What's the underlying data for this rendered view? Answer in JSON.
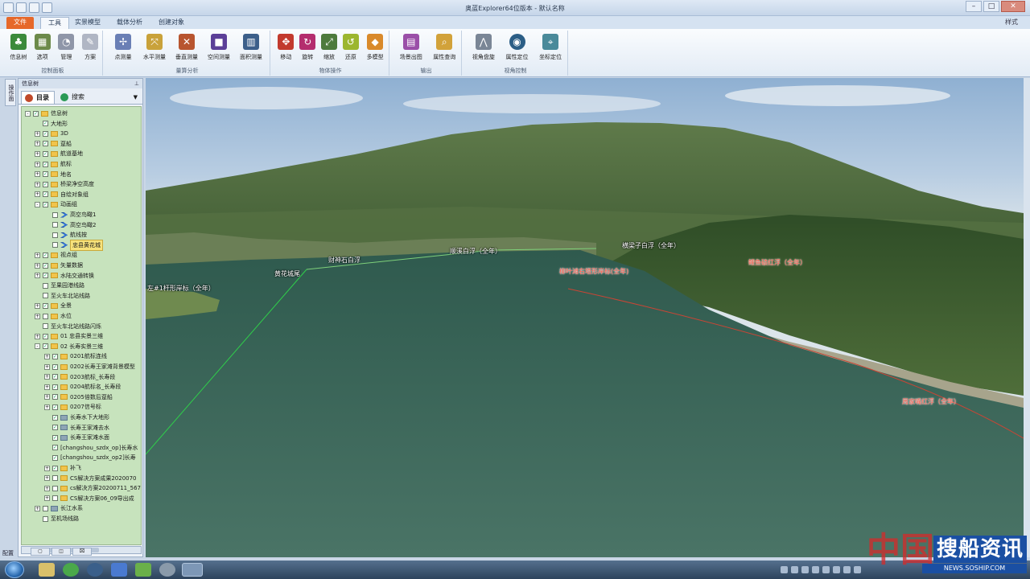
{
  "window": {
    "title": "奥蓝Explorer64位版本 - 默认名称"
  },
  "tabs": [
    {
      "label": "文件"
    },
    {
      "label": "工具"
    },
    {
      "label": "实景模型"
    },
    {
      "label": "载体分析"
    },
    {
      "label": "创建对象"
    }
  ],
  "style_label": "样式",
  "ribbon": {
    "groups": [
      {
        "label": "控制面板",
        "buttons": [
          "信息树",
          "选项",
          "管理",
          "方案"
        ]
      },
      {
        "label": "量算分析",
        "buttons": [
          "点测量",
          "水平测量",
          "垂直测量",
          "空间测量",
          "面积测量"
        ]
      },
      {
        "label": "物体操作",
        "buttons": [
          "移动",
          "旋转",
          "缩放",
          "还原",
          "多模型"
        ]
      },
      {
        "label": "输出",
        "buttons": [
          "场景出图",
          "属性查询"
        ]
      },
      {
        "label": "视角控制",
        "buttons": [
          "视角盘旋",
          "属性定位",
          "坐标定位"
        ]
      }
    ]
  },
  "panel": {
    "header": "信息树",
    "vertical_tab": "操作面",
    "tab_directory": "目录",
    "tab_search": "搜索",
    "config_label": "配置"
  },
  "tree": [
    {
      "label": "信息树",
      "level": 1,
      "check": true,
      "icon": "folder",
      "expand": "-"
    },
    {
      "label": "大地形",
      "level": 2,
      "check": true,
      "icon": "none",
      "expand": ""
    },
    {
      "label": "3D",
      "level": 2,
      "check": true,
      "icon": "folder",
      "expand": "+"
    },
    {
      "label": "趸船",
      "level": 2,
      "check": true,
      "icon": "folder",
      "expand": "+"
    },
    {
      "label": "航道基地",
      "level": 2,
      "check": true,
      "icon": "folder",
      "expand": "+"
    },
    {
      "label": "航标",
      "level": 2,
      "check": true,
      "icon": "folder",
      "expand": "+"
    },
    {
      "label": "地名",
      "level": 2,
      "check": true,
      "icon": "folder",
      "expand": "+"
    },
    {
      "label": "桥梁净空高度",
      "level": 2,
      "check": true,
      "icon": "folder",
      "expand": "+"
    },
    {
      "label": "自绘对象组",
      "level": 2,
      "check": true,
      "icon": "folder",
      "expand": "+"
    },
    {
      "label": "动画组",
      "level": 2,
      "check": true,
      "icon": "folder",
      "expand": "-"
    },
    {
      "label": "高空鸟瞰1",
      "level": 3,
      "check": false,
      "icon": "blue",
      "expand": ""
    },
    {
      "label": "高空鸟瞰2",
      "level": 3,
      "check": false,
      "icon": "blue",
      "expand": ""
    },
    {
      "label": "航线按",
      "level": 3,
      "check": false,
      "icon": "blue",
      "expand": ""
    },
    {
      "label": "忠县黄花城",
      "level": 3,
      "check": false,
      "icon": "blue",
      "expand": "",
      "selected": true
    },
    {
      "label": "视点组",
      "level": 2,
      "check": true,
      "icon": "folder",
      "expand": "+"
    },
    {
      "label": "矢量数据",
      "level": 2,
      "check": true,
      "icon": "folder",
      "expand": "+"
    },
    {
      "label": "水陆交通转换",
      "level": 2,
      "check": true,
      "icon": "folder",
      "expand": "+"
    },
    {
      "label": "至果园港线路",
      "level": 2,
      "check": false,
      "icon": "none",
      "expand": ""
    },
    {
      "label": "至火车北站线路",
      "level": 2,
      "check": false,
      "icon": "none",
      "expand": ""
    },
    {
      "label": "全景",
      "level": 2,
      "check": true,
      "icon": "folder",
      "expand": "+"
    },
    {
      "label": "水位",
      "level": 2,
      "check": false,
      "icon": "folder",
      "expand": "+"
    },
    {
      "label": "至火车北站线路闪烁",
      "level": 2,
      "check": false,
      "icon": "none",
      "expand": ""
    },
    {
      "label": "01 忠县实景三维",
      "level": 2,
      "check": true,
      "icon": "folder",
      "expand": "+"
    },
    {
      "label": "02 长寿实景三维",
      "level": 2,
      "check": true,
      "icon": "folder",
      "expand": "-"
    },
    {
      "label": "0201航标连线",
      "level": 3,
      "check": true,
      "icon": "folder",
      "expand": "+"
    },
    {
      "label": "0202长寿王家滩背景模型",
      "level": 3,
      "check": true,
      "icon": "folder",
      "expand": "+"
    },
    {
      "label": "0203航标_长寿段",
      "level": 3,
      "check": true,
      "icon": "folder",
      "expand": "+"
    },
    {
      "label": "0204航标名_长寿段",
      "level": 3,
      "check": true,
      "icon": "folder",
      "expand": "+"
    },
    {
      "label": "0205倍数后趸船",
      "level": 3,
      "check": true,
      "icon": "folder",
      "expand": "+"
    },
    {
      "label": "0207信号标",
      "level": 3,
      "check": true,
      "icon": "folder",
      "expand": "+"
    },
    {
      "label": "长寿水下大地形",
      "level": 3,
      "check": true,
      "icon": "gray",
      "expand": ""
    },
    {
      "label": "长寿王家滩去水",
      "level": 3,
      "check": true,
      "icon": "gray",
      "expand": ""
    },
    {
      "label": "长寿王家滩水面",
      "level": 3,
      "check": true,
      "icon": "gray",
      "expand": ""
    },
    {
      "label": "[changshou_szdx_op]长寿水",
      "level": 3,
      "check": true,
      "icon": "none",
      "expand": ""
    },
    {
      "label": "[changshou_szdx_op2]长寿",
      "level": 3,
      "check": true,
      "icon": "none",
      "expand": ""
    },
    {
      "label": "补飞",
      "level": 3,
      "check": true,
      "icon": "folder",
      "expand": "+"
    },
    {
      "label": "CS解决方案成果2020070",
      "level": 3,
      "check": false,
      "icon": "folder",
      "expand": "+"
    },
    {
      "label": "cs解决方案20200711_567",
      "level": 3,
      "check": false,
      "icon": "folder",
      "expand": "+"
    },
    {
      "label": "CS解决方案06_09导出成",
      "level": 3,
      "check": false,
      "icon": "folder",
      "expand": "+"
    },
    {
      "label": "长江水系",
      "level": 2,
      "check": false,
      "icon": "gray",
      "expand": "+"
    },
    {
      "label": "至机场线路",
      "level": 2,
      "check": false,
      "icon": "none",
      "expand": ""
    }
  ],
  "map_labels": [
    {
      "text": "横梁子白浮（全年）",
      "color": "white"
    },
    {
      "text": "顺溪白浮（全年）",
      "color": "white"
    },
    {
      "text": "财神石白浮",
      "color": "white"
    },
    {
      "text": "黄花城尾",
      "color": "white"
    },
    {
      "text": "左#1杆形岸标（全年）",
      "color": "white"
    },
    {
      "text": "柳叶滩右塔形岸标(全年)",
      "color": "red"
    },
    {
      "text": "鲤鱼碛红浮（全年）",
      "color": "red"
    },
    {
      "text": "周家嘴红浮（全年）",
      "color": "red"
    }
  ],
  "watermark": {
    "brand": "搜船资讯",
    "url": "NEWS.SOSHIP.COM",
    "overlay": "中国"
  },
  "colors": {
    "file_tab": "#e6682a",
    "tree_bg": "#c7e3bd",
    "water": "#3f6a5c",
    "red_label": "#ff5b4c"
  }
}
